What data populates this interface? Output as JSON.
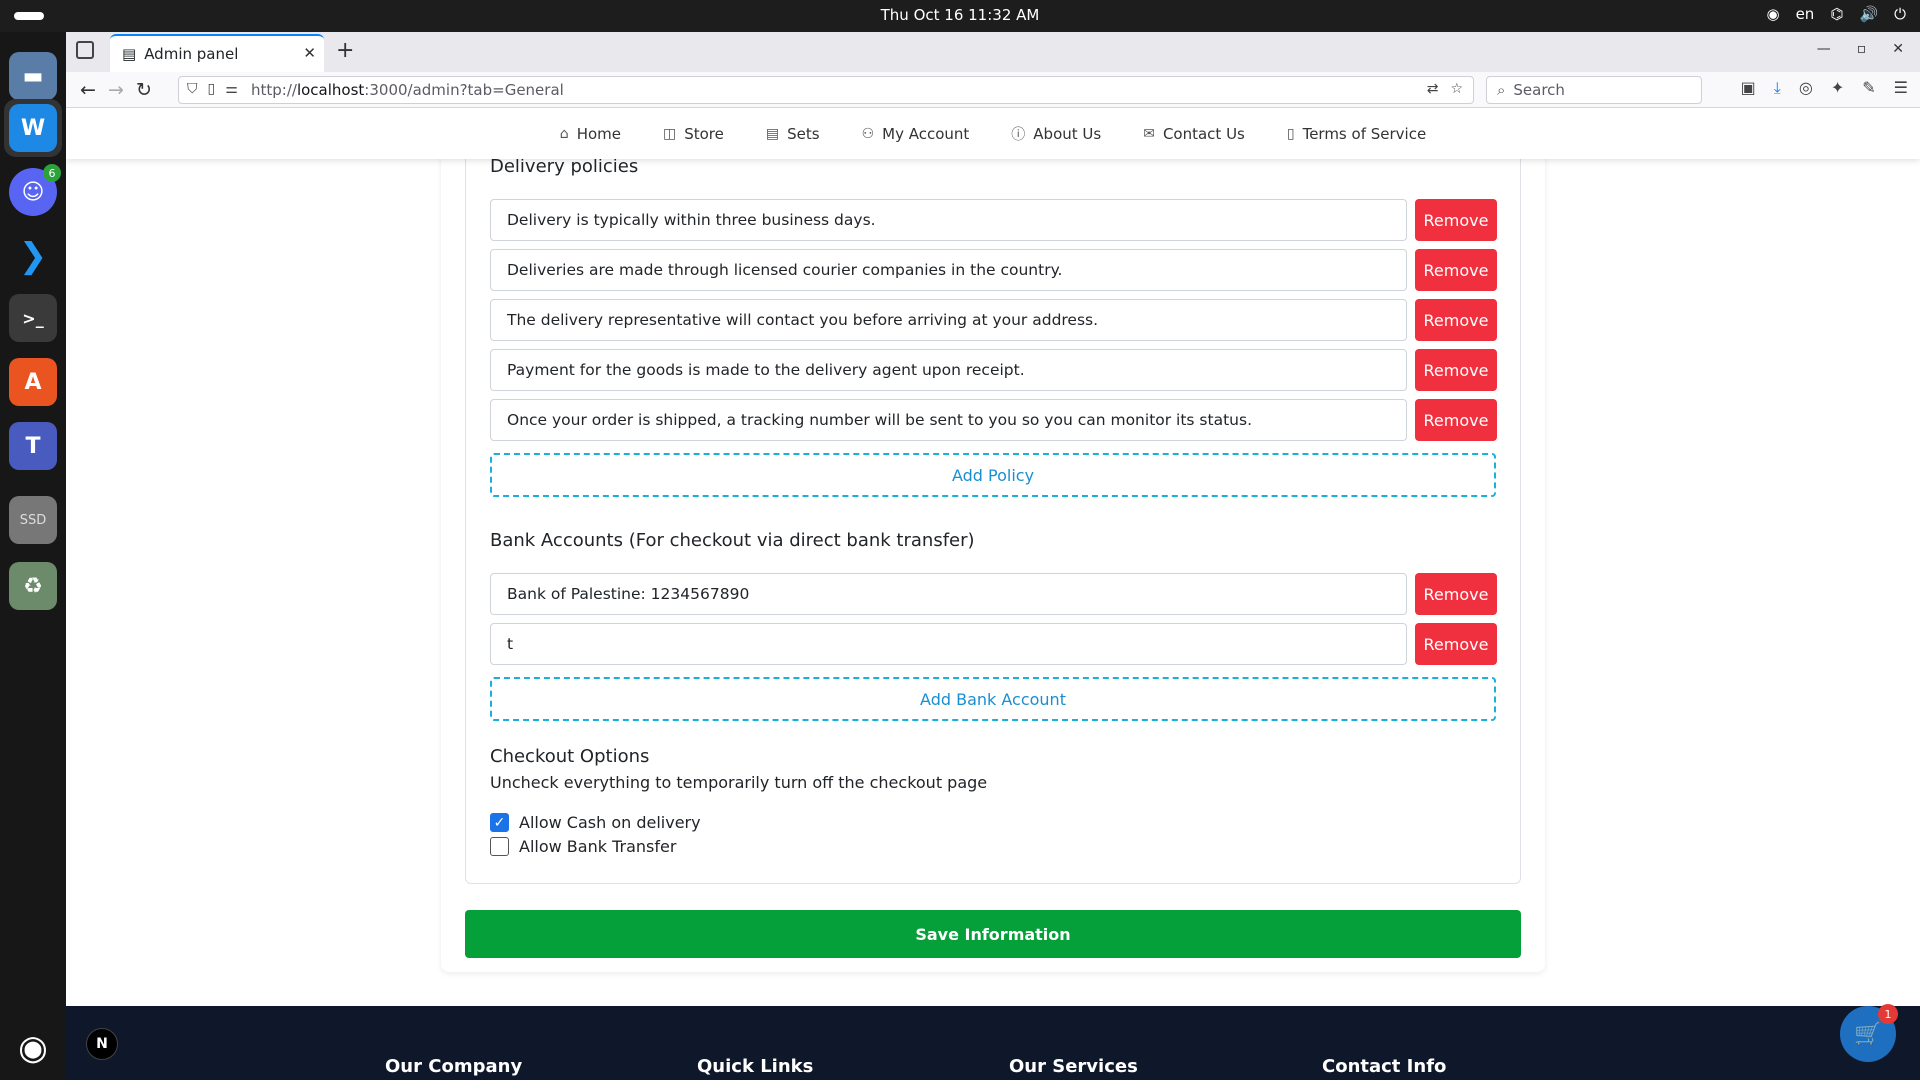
{
  "system": {
    "clock": "Thu Oct 16  11:32 AM",
    "language": "en"
  },
  "dock": {
    "discord_badge": "6",
    "ssd_label": "SSD",
    "ubuntu_logo": "ubuntu-logo"
  },
  "browser": {
    "tab_title": "Admin panel",
    "url_prefix": "http://",
    "url_host": "localhost",
    "url_rest": ":3000/admin?tab=General",
    "search_placeholder": "Search"
  },
  "site_nav": {
    "items": [
      {
        "label": "Home",
        "icon": "home-icon"
      },
      {
        "label": "Store",
        "icon": "bag-icon"
      },
      {
        "label": "Sets",
        "icon": "list-icon"
      },
      {
        "label": "My Account",
        "icon": "user-icon"
      },
      {
        "label": "About Us",
        "icon": "info-icon"
      },
      {
        "label": "Contact Us",
        "icon": "mail-icon"
      },
      {
        "label": "Terms of Service",
        "icon": "document-icon"
      }
    ]
  },
  "delivery": {
    "title": "Delivery policies",
    "policies": [
      "Delivery is typically within three business days.",
      "Deliveries are made through licensed courier companies in the country.",
      "The delivery representative will contact you before arriving at your address.",
      "Payment for the goods is made to the delivery agent upon receipt.",
      "Once your order is shipped, a tracking number will be sent to you so you can monitor its status."
    ],
    "remove_label": "Remove",
    "add_label": "Add Policy"
  },
  "bank": {
    "title": "Bank Accounts (For checkout via direct bank transfer)",
    "accounts": [
      "Bank of Palestine: 1234567890",
      "t"
    ],
    "remove_label": "Remove",
    "add_label": "Add Bank Account"
  },
  "checkout": {
    "title": "Checkout Options",
    "subtitle": "Uncheck everything to temporarily turn off the checkout page",
    "options": [
      {
        "label": "Allow Cash on delivery",
        "checked": true
      },
      {
        "label": "Allow Bank Transfer",
        "checked": false
      }
    ]
  },
  "save_label": "Save Information",
  "footer": {
    "columns": [
      "Our Company",
      "Quick Links",
      "Our Services",
      "Contact Info"
    ],
    "next_badge": "N"
  },
  "cart": {
    "count": "1"
  },
  "colors": {
    "remove": "#f0303e",
    "save": "#05a03a",
    "add_border": "#1ab0dc",
    "footer_bg": "#0f172a",
    "checkbox_checked": "#1a73e8"
  }
}
